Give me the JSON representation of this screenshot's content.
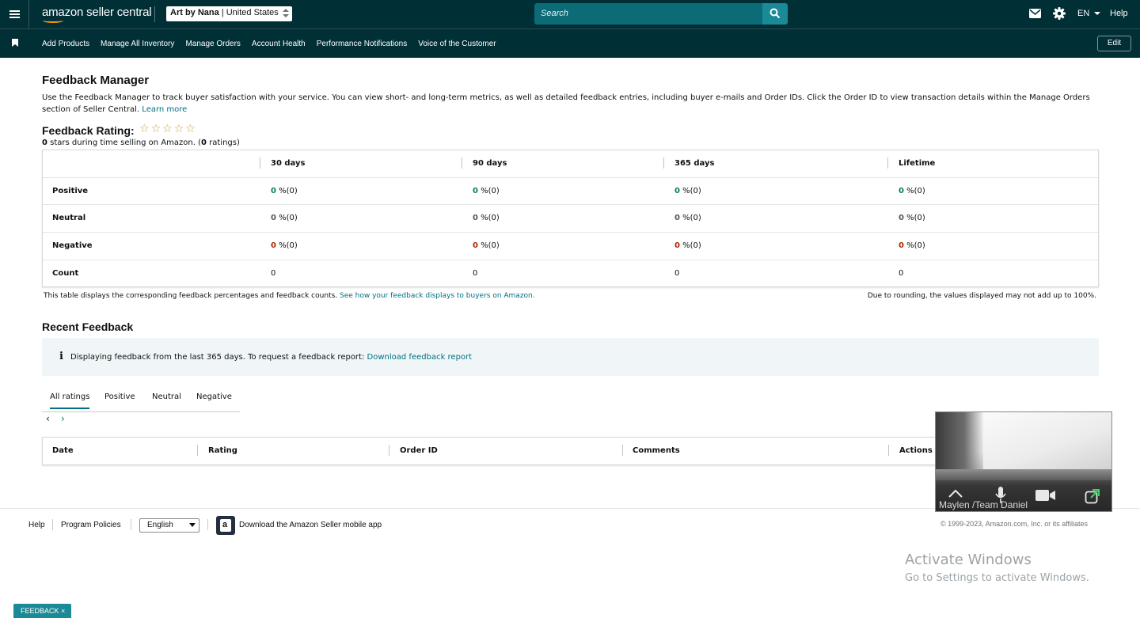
{
  "header": {
    "logo_text": "amazon seller central",
    "store": {
      "name": "Art by Nana",
      "region": "United States"
    },
    "search_placeholder": "Search",
    "language": "EN",
    "help": "Help"
  },
  "nav": {
    "items": [
      "Add Products",
      "Manage All Inventory",
      "Manage Orders",
      "Account Health",
      "Performance Notifications",
      "Voice of the Customer"
    ],
    "edit": "Edit"
  },
  "page": {
    "title": "Feedback Manager",
    "intro": "Use the Feedback Manager to track buyer satisfaction with your service. You can view short- and long-term metrics, as well as detailed feedback entries, including buyer e-mails and Order IDs. Click the Order ID to view transaction details within the Manage Orders section of Seller Central.",
    "learn_more": "Learn more"
  },
  "rating": {
    "title": "Feedback Rating:",
    "stars_value": 0,
    "stars_max": 5,
    "summary_stars": "0",
    "summary_text_1": " stars during time selling on Amazon. (",
    "summary_ratings": "0",
    "summary_text_2": " ratings)"
  },
  "metrics_table": {
    "columns": [
      "30 days",
      "90 days",
      "365 days",
      "Lifetime"
    ],
    "rows": [
      {
        "label": "Positive",
        "kind": "pos",
        "values": [
          "0",
          "0",
          "0",
          "0"
        ],
        "suffix": " %(0)"
      },
      {
        "label": "Neutral",
        "kind": "neu",
        "values": [
          "0",
          "0",
          "0",
          "0"
        ],
        "suffix": " %(0)"
      },
      {
        "label": "Negative",
        "kind": "neg",
        "values": [
          "0",
          "0",
          "0",
          "0"
        ],
        "suffix": " %(0)"
      },
      {
        "label": "Count",
        "kind": "count",
        "values": [
          "0",
          "0",
          "0",
          "0"
        ],
        "suffix": ""
      }
    ],
    "note_left": "This table displays the corresponding feedback percentages and feedback counts.",
    "note_link": "See how your feedback displays to buyers on Amazon.",
    "note_right": "Due to rounding, the values displayed may not add up to 100%."
  },
  "recent": {
    "title": "Recent Feedback",
    "info_icon": "i",
    "info_text": "Displaying feedback from the last 365 days. To request a feedback report:",
    "info_link": "Download feedback report",
    "tabs": [
      "All ratings",
      "Positive",
      "Neutral",
      "Negative"
    ],
    "active_tab": "All ratings",
    "pager_prev": "‹",
    "pager_next": "›",
    "columns": [
      "Date",
      "Rating",
      "Order ID",
      "Comments",
      "Actions"
    ]
  },
  "footer": {
    "help": "Help",
    "program_policies": "Program Policies",
    "language": "English",
    "app_text": "Download the Amazon Seller mobile app",
    "app_icon_letter": "a",
    "copyright": "© 1999-2023, Amazon.com, Inc. or its affiliates"
  },
  "video_overlay": {
    "name": "Maylen /Team Daniel"
  },
  "watermark": {
    "title": "Activate Windows",
    "subtitle": "Go to Settings to activate Windows."
  },
  "feedback_tab": "FEEDBACK ×",
  "colors": {
    "header_bg": "#002f36",
    "accent": "#007185",
    "positive": "#067d62",
    "negative": "#b12704",
    "star": "#c7a04a"
  }
}
